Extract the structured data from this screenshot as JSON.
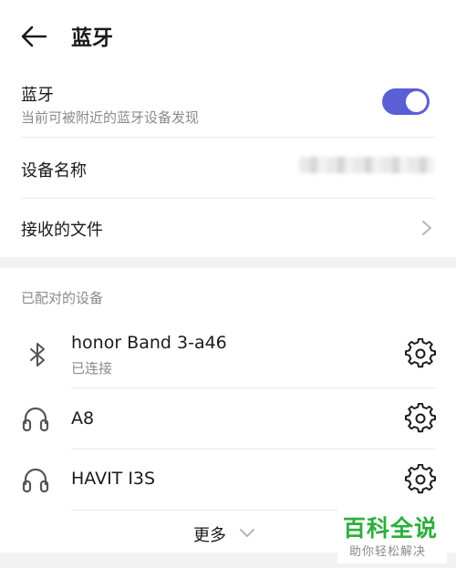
{
  "header": {
    "title": "蓝牙"
  },
  "bluetooth": {
    "label": "蓝牙",
    "subtitle": "当前可被附近的蓝牙设备发现",
    "enabled": true
  },
  "device_name": {
    "label": "设备名称"
  },
  "received_files": {
    "label": "接收的文件"
  },
  "paired": {
    "section_title": "已配对的设备",
    "devices": [
      {
        "name": "honor Band 3-a46",
        "status": "已连接",
        "icon": "bluetooth-icon"
      },
      {
        "name": "A8",
        "status": "",
        "icon": "headphones-icon"
      },
      {
        "name": "HAVIT I3S",
        "status": "",
        "icon": "headphones-icon"
      }
    ]
  },
  "more": {
    "label": "更多"
  },
  "watermark": {
    "title": "百科全说",
    "subtitle": "助你轻松解决"
  },
  "colors": {
    "accent": "#5B5FD6",
    "watermark": "#2cae3c"
  }
}
